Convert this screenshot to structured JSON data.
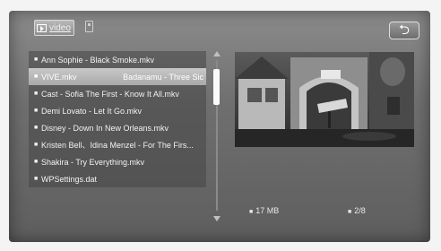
{
  "topbar": {
    "video_tab_label": "video",
    "video_icon": "video-icon",
    "sd_icon": "sd-card-icon",
    "back_icon": "back-arrow-icon",
    "back_glyph": "⮌"
  },
  "files": [
    {
      "name": "Ann Sophie - Black Smoke.mkv",
      "selected": false
    },
    {
      "name": "VIVE.mkv",
      "selected": true,
      "scrolling_text": "Badanamu - Three Sic"
    },
    {
      "name": "Cast - Sofia The First - Know It All.mkv",
      "selected": false
    },
    {
      "name": "Demi Lovato - Let It Go.mkv",
      "selected": false
    },
    {
      "name": "Disney - Down In New Orleans.mkv",
      "selected": false
    },
    {
      "name": "Kristen Bell、Idina Menzel - For The Firs...",
      "selected": false
    },
    {
      "name": "Shakira - Try Everything.mkv",
      "selected": false
    },
    {
      "name": "WPSettings.dat",
      "selected": false
    }
  ],
  "bullet": "■",
  "info": {
    "size": "17 MB",
    "position": "2/8"
  },
  "colors": {
    "selected_row": "#b8b8b8",
    "panel": "#6f6f6f"
  }
}
